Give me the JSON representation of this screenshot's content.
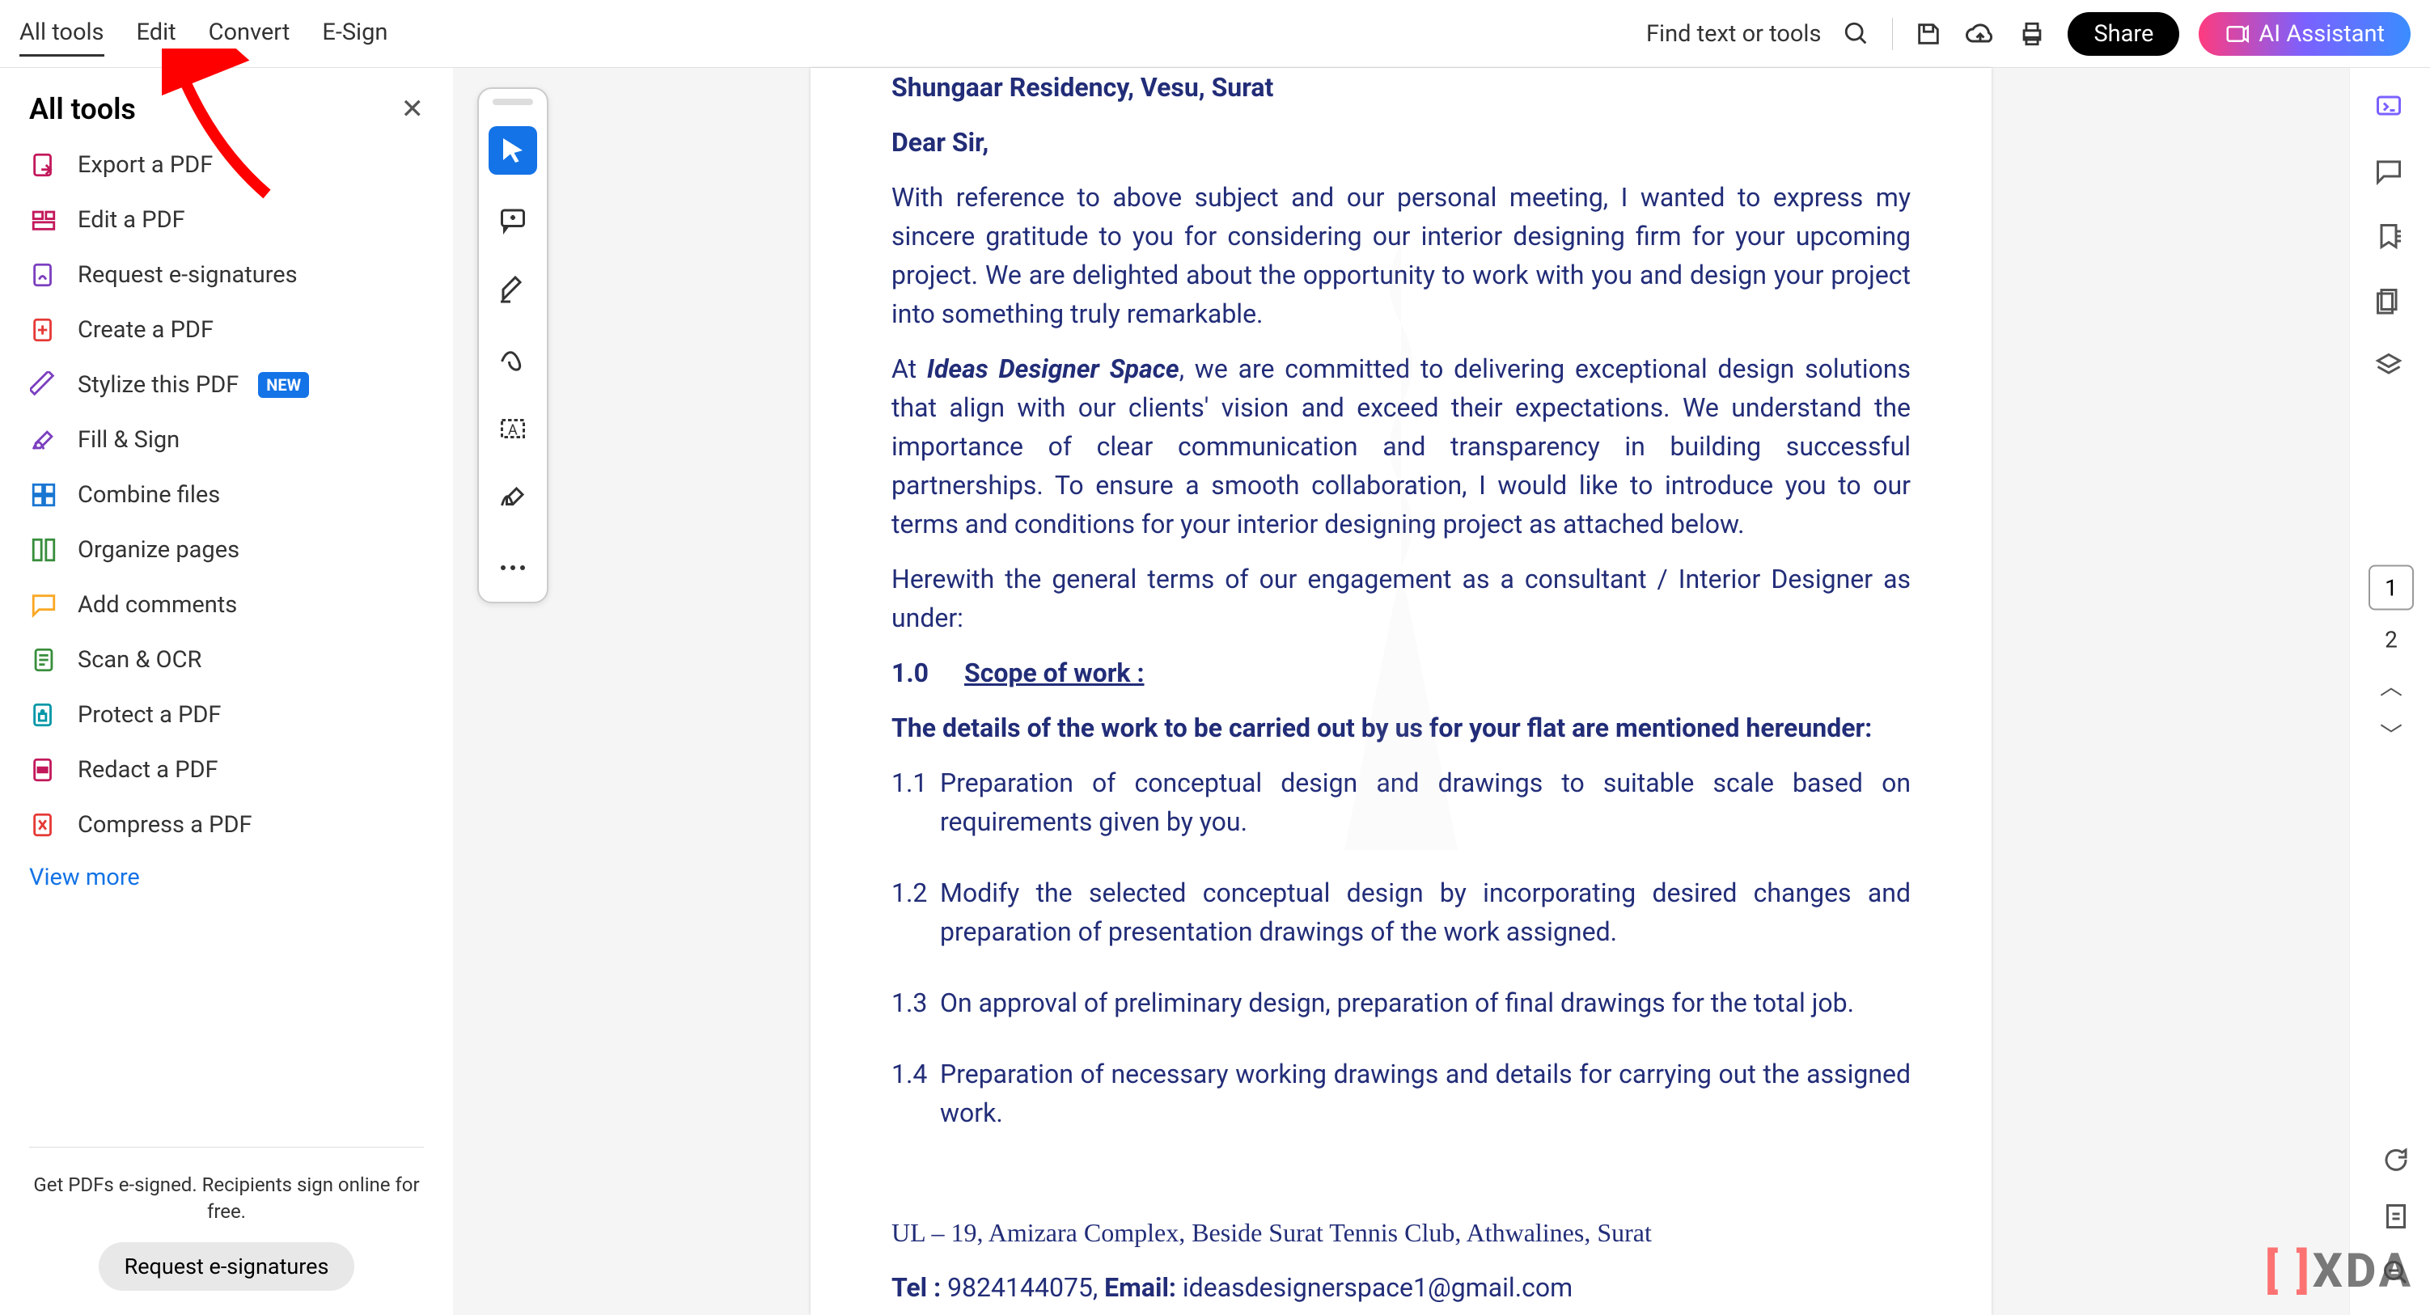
{
  "menu": {
    "all_tools": "All tools",
    "edit": "Edit",
    "convert": "Convert",
    "esign": "E-Sign"
  },
  "topbar": {
    "find": "Find text or tools",
    "share": "Share",
    "ai": "AI Assistant"
  },
  "sidebar": {
    "title": "All tools",
    "items": [
      "Export a PDF",
      "Edit a PDF",
      "Request e-signatures",
      "Create a PDF",
      "Stylize this PDF",
      "Fill & Sign",
      "Combine files",
      "Organize pages",
      "Add comments",
      "Scan & OCR",
      "Protect a PDF",
      "Redact a PDF",
      "Compress a PDF"
    ],
    "new_badge": "NEW",
    "view_more": "View more",
    "footer_text": "Get PDFs e-signed. Recipients sign online for free.",
    "footer_btn": "Request e-signatures"
  },
  "doc": {
    "address": "Shungaar Residency, Vesu, Surat",
    "dear": "Dear Sir,",
    "p1a": "With reference to above subject and our personal meeting, I wanted to express my sincere gratitude to you for considering our interior designing firm for your upcoming project. We are delighted about the opportunity to work with you and design your project into something truly remarkable.",
    "p2_pre": "At ",
    "p2_company": "Ideas Designer Space",
    "p2_post": ", we are committed to delivering exceptional design solutions that align with our clients' vision and exceed their expectations. We understand the importance of clear communication and transparency in building successful partnerships. To ensure a smooth collaboration, I would like to introduce you to our terms and conditions for your interior designing project as attached below.",
    "p3": "Herewith the general terms of our engagement as a consultant / Interior Designer as under:",
    "scope_num": "1.0",
    "scope_title": "Scope of work :",
    "details": "The details of the work to be carried out by us for your flat are mentioned hereunder:",
    "i11n": "1.1",
    "i11": "Preparation of conceptual design and drawings to suitable scale based on requirements given by you.",
    "i12n": "1.2",
    "i12": "Modify the selected conceptual design by incorporating desired changes and preparation of presentation drawings of the work assigned.",
    "i13n": "1.3",
    "i13": "On approval of preliminary design, preparation of final drawings for the total job.",
    "i14n": "1.4",
    "i14": "Preparation of necessary working drawings and details for carrying out the assigned work.",
    "footer1": "UL – 19, Amizara Complex, Beside Surat Tennis Club, Athwalines, Surat",
    "footer2_pre": "Tel : ",
    "footer2_tel": "9824144075, ",
    "footer2_em": "Email: ",
    "footer2_mail": "ideasdesignerspace1@gmail.com"
  },
  "page_nav": {
    "current": "1",
    "other": "2"
  },
  "xda": "XDA"
}
